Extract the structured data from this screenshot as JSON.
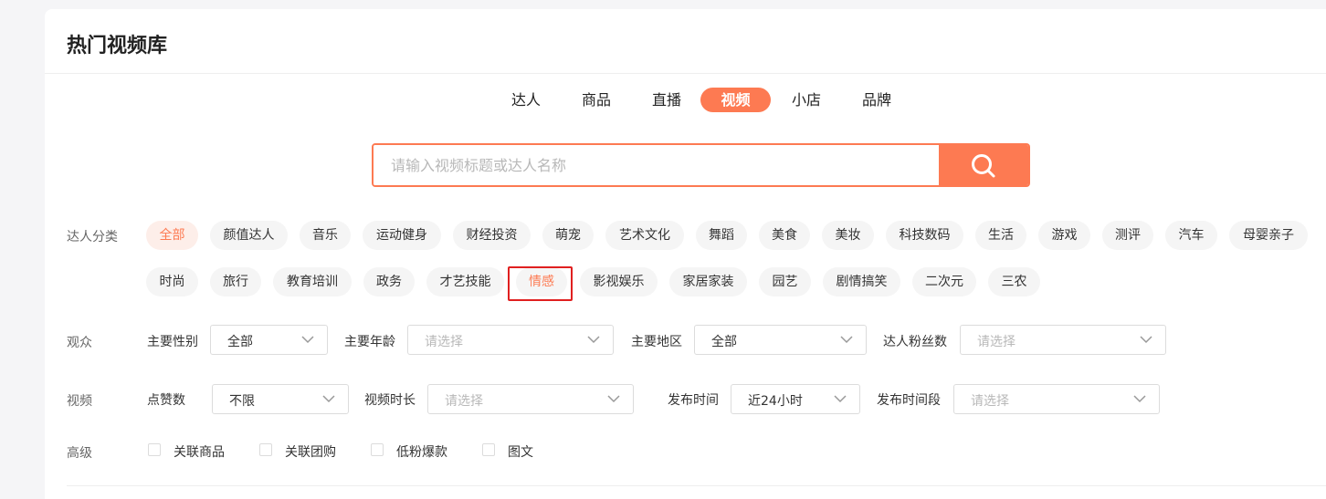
{
  "header": {
    "title": "热门视频库"
  },
  "type_tabs": [
    {
      "label": "达人"
    },
    {
      "label": "商品"
    },
    {
      "label": "直播"
    },
    {
      "label": "视频"
    },
    {
      "label": "小店"
    },
    {
      "label": "品牌"
    }
  ],
  "search": {
    "placeholder": "请输入视频标题或达人名称"
  },
  "category": {
    "label": "达人分类",
    "items": [
      "全部",
      "颜值达人",
      "音乐",
      "运动健身",
      "财经投资",
      "萌宠",
      "艺术文化",
      "舞蹈",
      "美食",
      "美妆",
      "科技数码",
      "生活",
      "游戏",
      "测评",
      "汽车",
      "母婴亲子",
      "时尚",
      "旅行",
      "教育培训",
      "政务",
      "才艺技能",
      "情感",
      "影视娱乐",
      "家居家装",
      "园艺",
      "剧情搞笑",
      "二次元",
      "三农"
    ]
  },
  "audience": {
    "label": "观众",
    "fields": [
      {
        "label": "主要性别",
        "value": "全部",
        "placeholder": false
      },
      {
        "label": "主要年龄",
        "value": "请选择",
        "placeholder": true
      },
      {
        "label": "主要地区",
        "value": "全部",
        "placeholder": false
      },
      {
        "label": "达人粉丝数",
        "value": "请选择",
        "placeholder": true
      }
    ]
  },
  "video": {
    "label": "视频",
    "fields": [
      {
        "label": "点赞数",
        "value": "不限",
        "placeholder": false
      },
      {
        "label": "视频时长",
        "value": "请选择",
        "placeholder": true
      },
      {
        "label": "发布时间",
        "value": "近24小时",
        "placeholder": false
      },
      {
        "label": "发布时间段",
        "value": "请选择",
        "placeholder": true
      }
    ]
  },
  "advanced": {
    "label": "高级",
    "options": [
      "关联商品",
      "关联团购",
      "低粉爆款",
      "图文"
    ]
  },
  "colors": {
    "accent": "#fd7a52",
    "highlight": "#e02020"
  }
}
